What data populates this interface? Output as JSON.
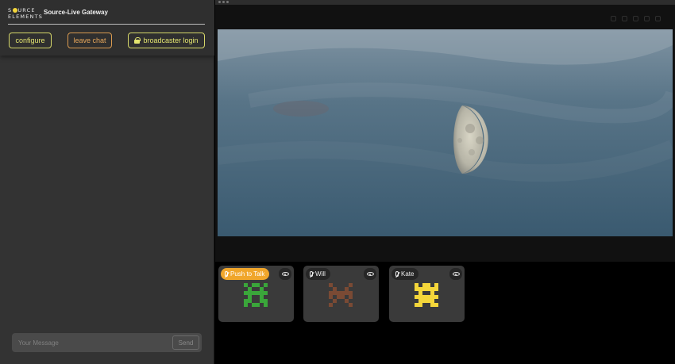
{
  "header": {
    "logo_line1": "S",
    "logo_line1_rest": "URCE",
    "logo_line2": "ELEMENTS",
    "app_title": "Source-Live Gateway"
  },
  "buttons": {
    "configure": "configure",
    "leave_chat": "leave chat",
    "broadcaster_login": "broadcaster login"
  },
  "chat": {
    "placeholder": "Your Message",
    "send_label": "Send"
  },
  "participants": [
    {
      "label": "Push to Talk",
      "avatar_color": "#3aa63a",
      "tag_color": "#f0a62b"
    },
    {
      "label": "Will",
      "avatar_color": "#7a4a34"
    },
    {
      "label": "Kate",
      "avatar_color": "#f4d63a"
    }
  ],
  "colors": {
    "accent_yellow": "#e4e56f",
    "accent_orange": "#e6a65a",
    "panel_bg": "#333333",
    "sky": "#3f5f77"
  },
  "icons": [
    "lock-icon",
    "mic-muted-icon",
    "eye-icon"
  ]
}
